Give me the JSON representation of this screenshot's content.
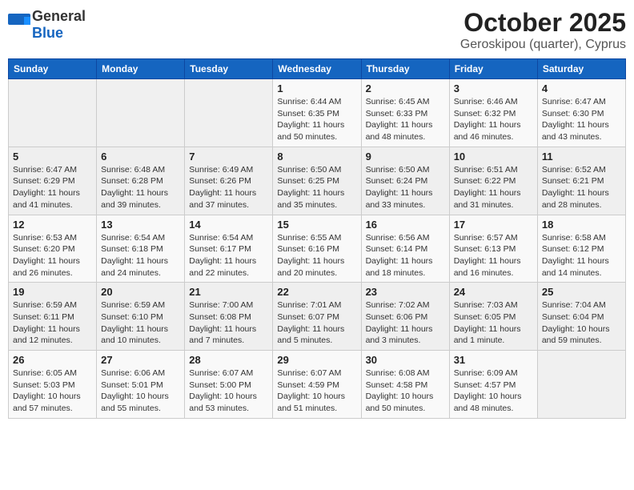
{
  "header": {
    "logo_general": "General",
    "logo_blue": "Blue",
    "month": "October 2025",
    "location": "Geroskipou (quarter), Cyprus"
  },
  "weekdays": [
    "Sunday",
    "Monday",
    "Tuesday",
    "Wednesday",
    "Thursday",
    "Friday",
    "Saturday"
  ],
  "weeks": [
    [
      {
        "day": "",
        "sunrise": "",
        "sunset": "",
        "daylight": ""
      },
      {
        "day": "",
        "sunrise": "",
        "sunset": "",
        "daylight": ""
      },
      {
        "day": "",
        "sunrise": "",
        "sunset": "",
        "daylight": ""
      },
      {
        "day": "1",
        "sunrise": "Sunrise: 6:44 AM",
        "sunset": "Sunset: 6:35 PM",
        "daylight": "Daylight: 11 hours and 50 minutes."
      },
      {
        "day": "2",
        "sunrise": "Sunrise: 6:45 AM",
        "sunset": "Sunset: 6:33 PM",
        "daylight": "Daylight: 11 hours and 48 minutes."
      },
      {
        "day": "3",
        "sunrise": "Sunrise: 6:46 AM",
        "sunset": "Sunset: 6:32 PM",
        "daylight": "Daylight: 11 hours and 46 minutes."
      },
      {
        "day": "4",
        "sunrise": "Sunrise: 6:47 AM",
        "sunset": "Sunset: 6:30 PM",
        "daylight": "Daylight: 11 hours and 43 minutes."
      }
    ],
    [
      {
        "day": "5",
        "sunrise": "Sunrise: 6:47 AM",
        "sunset": "Sunset: 6:29 PM",
        "daylight": "Daylight: 11 hours and 41 minutes."
      },
      {
        "day": "6",
        "sunrise": "Sunrise: 6:48 AM",
        "sunset": "Sunset: 6:28 PM",
        "daylight": "Daylight: 11 hours and 39 minutes."
      },
      {
        "day": "7",
        "sunrise": "Sunrise: 6:49 AM",
        "sunset": "Sunset: 6:26 PM",
        "daylight": "Daylight: 11 hours and 37 minutes."
      },
      {
        "day": "8",
        "sunrise": "Sunrise: 6:50 AM",
        "sunset": "Sunset: 6:25 PM",
        "daylight": "Daylight: 11 hours and 35 minutes."
      },
      {
        "day": "9",
        "sunrise": "Sunrise: 6:50 AM",
        "sunset": "Sunset: 6:24 PM",
        "daylight": "Daylight: 11 hours and 33 minutes."
      },
      {
        "day": "10",
        "sunrise": "Sunrise: 6:51 AM",
        "sunset": "Sunset: 6:22 PM",
        "daylight": "Daylight: 11 hours and 31 minutes."
      },
      {
        "day": "11",
        "sunrise": "Sunrise: 6:52 AM",
        "sunset": "Sunset: 6:21 PM",
        "daylight": "Daylight: 11 hours and 28 minutes."
      }
    ],
    [
      {
        "day": "12",
        "sunrise": "Sunrise: 6:53 AM",
        "sunset": "Sunset: 6:20 PM",
        "daylight": "Daylight: 11 hours and 26 minutes."
      },
      {
        "day": "13",
        "sunrise": "Sunrise: 6:54 AM",
        "sunset": "Sunset: 6:18 PM",
        "daylight": "Daylight: 11 hours and 24 minutes."
      },
      {
        "day": "14",
        "sunrise": "Sunrise: 6:54 AM",
        "sunset": "Sunset: 6:17 PM",
        "daylight": "Daylight: 11 hours and 22 minutes."
      },
      {
        "day": "15",
        "sunrise": "Sunrise: 6:55 AM",
        "sunset": "Sunset: 6:16 PM",
        "daylight": "Daylight: 11 hours and 20 minutes."
      },
      {
        "day": "16",
        "sunrise": "Sunrise: 6:56 AM",
        "sunset": "Sunset: 6:14 PM",
        "daylight": "Daylight: 11 hours and 18 minutes."
      },
      {
        "day": "17",
        "sunrise": "Sunrise: 6:57 AM",
        "sunset": "Sunset: 6:13 PM",
        "daylight": "Daylight: 11 hours and 16 minutes."
      },
      {
        "day": "18",
        "sunrise": "Sunrise: 6:58 AM",
        "sunset": "Sunset: 6:12 PM",
        "daylight": "Daylight: 11 hours and 14 minutes."
      }
    ],
    [
      {
        "day": "19",
        "sunrise": "Sunrise: 6:59 AM",
        "sunset": "Sunset: 6:11 PM",
        "daylight": "Daylight: 11 hours and 12 minutes."
      },
      {
        "day": "20",
        "sunrise": "Sunrise: 6:59 AM",
        "sunset": "Sunset: 6:10 PM",
        "daylight": "Daylight: 11 hours and 10 minutes."
      },
      {
        "day": "21",
        "sunrise": "Sunrise: 7:00 AM",
        "sunset": "Sunset: 6:08 PM",
        "daylight": "Daylight: 11 hours and 7 minutes."
      },
      {
        "day": "22",
        "sunrise": "Sunrise: 7:01 AM",
        "sunset": "Sunset: 6:07 PM",
        "daylight": "Daylight: 11 hours and 5 minutes."
      },
      {
        "day": "23",
        "sunrise": "Sunrise: 7:02 AM",
        "sunset": "Sunset: 6:06 PM",
        "daylight": "Daylight: 11 hours and 3 minutes."
      },
      {
        "day": "24",
        "sunrise": "Sunrise: 7:03 AM",
        "sunset": "Sunset: 6:05 PM",
        "daylight": "Daylight: 11 hours and 1 minute."
      },
      {
        "day": "25",
        "sunrise": "Sunrise: 7:04 AM",
        "sunset": "Sunset: 6:04 PM",
        "daylight": "Daylight: 10 hours and 59 minutes."
      }
    ],
    [
      {
        "day": "26",
        "sunrise": "Sunrise: 6:05 AM",
        "sunset": "Sunset: 5:03 PM",
        "daylight": "Daylight: 10 hours and 57 minutes."
      },
      {
        "day": "27",
        "sunrise": "Sunrise: 6:06 AM",
        "sunset": "Sunset: 5:01 PM",
        "daylight": "Daylight: 10 hours and 55 minutes."
      },
      {
        "day": "28",
        "sunrise": "Sunrise: 6:07 AM",
        "sunset": "Sunset: 5:00 PM",
        "daylight": "Daylight: 10 hours and 53 minutes."
      },
      {
        "day": "29",
        "sunrise": "Sunrise: 6:07 AM",
        "sunset": "Sunset: 4:59 PM",
        "daylight": "Daylight: 10 hours and 51 minutes."
      },
      {
        "day": "30",
        "sunrise": "Sunrise: 6:08 AM",
        "sunset": "Sunset: 4:58 PM",
        "daylight": "Daylight: 10 hours and 50 minutes."
      },
      {
        "day": "31",
        "sunrise": "Sunrise: 6:09 AM",
        "sunset": "Sunset: 4:57 PM",
        "daylight": "Daylight: 10 hours and 48 minutes."
      },
      {
        "day": "",
        "sunrise": "",
        "sunset": "",
        "daylight": ""
      }
    ]
  ]
}
